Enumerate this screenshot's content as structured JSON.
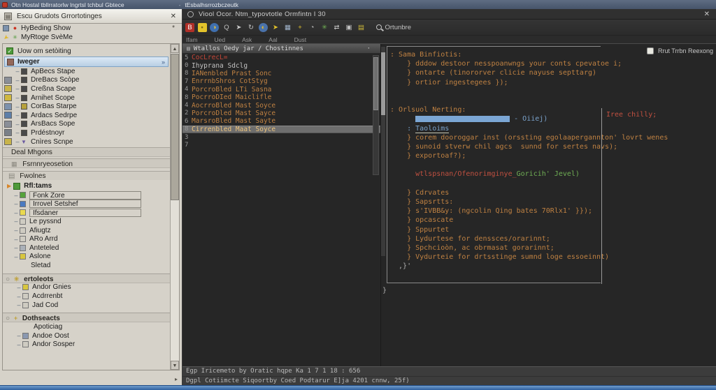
{
  "window": {
    "title": "Otn Hostal tbllrratorlw lngrtsl tchbul Gbtece",
    "title_suffix": "tEsbalhsrrozbczeutk"
  },
  "left_panel": {
    "header_title": "Escu Grudots Grrortotinges",
    "close_label": "✕",
    "top_rows": [
      {
        "label": "HyBeding Show",
        "right": "*"
      },
      {
        "label": "MyRtoge SvèMe",
        "right": ""
      }
    ],
    "view_row": "Uow om setòiting",
    "selected_row": "Iweger",
    "selected_chevron": "»",
    "scopes": [
      {
        "label": "ApBecs Stape",
        "icon": "#4a4a4a",
        "gutter": ""
      },
      {
        "label": "DreBacs Scòpe",
        "icon": "#4a4a4a",
        "gutter": "#8a8f98"
      },
      {
        "label": "Creßna Scape",
        "icon": "#4a4a4a",
        "gutter": "#c8b44a"
      },
      {
        "label": "Arnihet Scope",
        "icon": "#4a4a4a",
        "gutter": "#d0b83e"
      },
      {
        "label": "CorBas Starpe",
        "icon": "#b8a23c",
        "gutter": "#7d92ad"
      },
      {
        "label": "Ardacs Sedrpe",
        "icon": "#4a4a4a",
        "gutter": "#5d7fa8"
      },
      {
        "label": "ArsBacs Sope",
        "icon": "#4a4a4a",
        "gutter": "#8a8f98"
      },
      {
        "label": "Prdéstnoyr",
        "icon": "#4a4a4a",
        "gutter": "#7a8088"
      },
      {
        "label": "Cnìres Scnpe",
        "icon": "tri",
        "gutter": "#c8b44a"
      }
    ],
    "sections": [
      "Deal Mhgons",
      "Fsrnnryeosetion"
    ],
    "fwolnes_title": "Fwolnes",
    "fwolnes_parent": "Rfl:tams",
    "fwolnes_boxed": [
      {
        "label": "Fonk Zore",
        "icon": "#55a23b"
      },
      {
        "label": "Irrovel Setshef",
        "icon": "#4a7ac0"
      },
      {
        "label": "Ifsdaner",
        "icon": "#ead94e"
      }
    ],
    "fwolnes_plain": [
      {
        "label": "Le pyssnd",
        "icon": "#cfccc2"
      },
      {
        "label": "Afiugtz",
        "icon": "#cfccc2"
      },
      {
        "label": "ARo Arrd",
        "icon": "#cfccc2"
      },
      {
        "label": "Anteteled",
        "icon": "#aab0b8"
      },
      {
        "label": "Aslone",
        "icon": "#d8c63e"
      },
      {
        "label": "Sletad",
        "icon": ""
      }
    ],
    "ertoleots_title": "ertoleots",
    "ertoleots_glyphs": {
      "g1": "○",
      "g2": "✳"
    },
    "ertoleots_items": [
      {
        "label": "Andor Gnies",
        "icon": "#d8c63e"
      },
      {
        "label": "Acdrrenbt",
        "icon": "#cfccc2"
      },
      {
        "label": "Jad Cod",
        "icon": "#cfccc2"
      }
    ],
    "dothseacts_title": "Dothseacts",
    "dothseacts_glyphs": {
      "g1": "○",
      "g2": "+"
    },
    "dothseacts_items": [
      {
        "label": "Apoticiag",
        "icon": ""
      },
      {
        "label": "Andoe Oost",
        "icon": "#8a98b0"
      },
      {
        "label": "Andor Sosper",
        "icon": "#cfccc2"
      }
    ]
  },
  "editor": {
    "panel_title": "Viool Ocor. Ntm_typovtotle Ormfintn I 30",
    "close_label": "✕",
    "toolbar_icons": [
      {
        "name": "stop-icon",
        "glyph": "B",
        "fg": "#ffffff",
        "bg": "#b03028"
      },
      {
        "name": "breakpoint-icon",
        "glyph": "▪",
        "fg": "#7a6a1a",
        "bg": "#e3c32b"
      },
      {
        "name": "pie-icon",
        "glyph": "◑",
        "fg": "#e8c23a",
        "bg": "#3f6fae",
        "round": true
      },
      {
        "name": "chat-icon",
        "glyph": "Q",
        "fg": "#c2c2c2",
        "bg": ""
      },
      {
        "name": "run-icon",
        "glyph": "➤",
        "fg": "#c8c8c8",
        "bg": ""
      },
      {
        "name": "refresh-icon",
        "glyph": "↻",
        "fg": "#c8c8c8",
        "bg": ""
      },
      {
        "name": "globe-icon",
        "glyph": "◐",
        "fg": "#e0b82e",
        "bg": "#4a72aa",
        "round": true
      },
      {
        "name": "cursor-icon",
        "glyph": "➤",
        "fg": "#e3c32b",
        "bg": ""
      },
      {
        "name": "grid-icon",
        "glyph": "▦",
        "fg": "#9fb2c8",
        "bg": ""
      },
      {
        "name": "add-icon",
        "glyph": "+",
        "fg": "#e3c32b",
        "bg": ""
      },
      {
        "name": "history-icon",
        "glyph": "◔",
        "fg": "#c2c2c2",
        "bg": ""
      },
      {
        "name": "star-icon",
        "glyph": "✳",
        "fg": "#6fae54",
        "bg": ""
      },
      {
        "name": "swap-icon",
        "glyph": "⇄",
        "fg": "#c8c8c8",
        "bg": ""
      },
      {
        "name": "frame-icon",
        "glyph": "▣",
        "fg": "#c2c2c2",
        "bg": ""
      },
      {
        "name": "layers-icon",
        "glyph": "▤",
        "fg": "#cdb83a",
        "bg": ""
      }
    ],
    "search_label": "Ortunbre",
    "menu_items": [
      "Ifam",
      "Ued",
      "Ask",
      "Aal",
      "Dust"
    ],
    "run_label": "Rrut Trrbn Reexong",
    "list": {
      "header": "Wtallos Oedy jar / Chostinnes",
      "rows": [
        {
          "num": "5",
          "text": "CocLrecL=",
          "color": "red"
        },
        {
          "num": "0",
          "text": "Ihyprana Sdclg",
          "color": "grey"
        },
        {
          "num": "8",
          "text": "IANenbled Prast Sonc",
          "color": "orange"
        },
        {
          "num": "7",
          "text": "EnrrnbShros CotStyg",
          "color": "orange"
        },
        {
          "num": "4",
          "text": "PorcroBled LTi Sasna",
          "color": "orange"
        },
        {
          "num": "8",
          "text": "PocrroDIed Maiclifle",
          "color": "orange"
        },
        {
          "num": "4",
          "text": "AocrroBled Mast Soyce",
          "color": "orange"
        },
        {
          "num": "2",
          "text": "PorcroDled Mast Sayce",
          "color": "orange"
        },
        {
          "num": "6",
          "text": "MarsroBled Mast Sayte",
          "color": "orange"
        },
        {
          "num": "8",
          "text": "Cirrenbled Maat Soyce",
          "color": "orange",
          "selected": true
        }
      ],
      "trailing_nums": [
        "3",
        "7"
      ]
    },
    "code": {
      "float_note": "Iree chilly;",
      "closing": "}",
      "lines": [
        {
          "parts": [
            [
              ": Sama Binfiotis:",
              "o"
            ]
          ]
        },
        {
          "parts": [
            [
              "    } dddow destoor nesspoanwngs your conts cpevatoe i;",
              "o"
            ]
          ]
        },
        {
          "parts": [
            [
              "    } ontarte (tinororver clicie nayuse septtarg)",
              "o"
            ]
          ]
        },
        {
          "parts": [
            [
              "    } ortior ingestegees });",
              "o"
            ]
          ]
        },
        {
          "parts": []
        },
        {
          "parts": []
        },
        {
          "parts": [
            [
              ": Orlsuol Nerting:",
              "o"
            ]
          ]
        },
        {
          "pre": "      ",
          "sel": true,
          "parts": [
            [
              " - Oiiej)",
              "b"
            ]
          ]
        },
        {
          "parts": [
            [
              "    : ",
              "b"
            ],
            [
              "Taoloims",
              "bu"
            ]
          ]
        },
        {
          "parts": [
            [
              "    } corem dooroggar inst (orssting egolaapergannton' lovrt wenes",
              "o"
            ]
          ]
        },
        {
          "parts": [
            [
              "    } sunoid stverw chil agcs  sunnd for sertes navs);",
              "o"
            ]
          ]
        },
        {
          "parts": [
            [
              "    } exportoaf?);",
              "o"
            ]
          ]
        },
        {
          "parts": []
        },
        {
          "parts": [
            [
              "      wtlspsnan/Ofenorimginye_",
              "r"
            ],
            [
              "Goricih' Jevel)",
              "g"
            ]
          ]
        },
        {
          "parts": []
        },
        {
          "parts": [
            [
              "    } Cdrvates",
              "o"
            ]
          ]
        },
        {
          "parts": [
            [
              "    } Sapsrtts:",
              "o"
            ]
          ]
        },
        {
          "parts": [
            [
              "    } s'IVBB&y: (ngcolin Qing bates 70Rlx1' }});",
              "o"
            ]
          ]
        },
        {
          "parts": [
            [
              "    } opcascate",
              "o"
            ]
          ]
        },
        {
          "parts": [
            [
              "    } Sppurtet",
              "o"
            ]
          ]
        },
        {
          "parts": [
            [
              "    } Lydurtese for denssces/orarinnt;",
              "o"
            ]
          ]
        },
        {
          "parts": [
            [
              "    } Spchcioòn, ac obrmasat gorarinnt;",
              "o"
            ]
          ]
        },
        {
          "parts": [
            [
              "    } Vydurteie for drtsstinge sumnd loge essoeinnt)",
              "o"
            ]
          ]
        },
        {
          "parts": [
            [
              "  ,}'",
              "w"
            ]
          ]
        }
      ]
    },
    "status_lines": [
      "Egp Iricemeto by Oratic hqpe Ka 1 7 1 18 : 656",
      "Dgpl Cotiimcte Siqoortby Coed Podtarur E]ja 4201 cnnw, 25f)"
    ]
  },
  "colors": {
    "accent_orange": "#bf8142",
    "accent_blue": "#7aa3cc",
    "accent_red": "#c05040",
    "accent_green": "#6fae54",
    "selection_bar": "#7ba6d4",
    "taskbar_blue": "#2e5f9e"
  }
}
